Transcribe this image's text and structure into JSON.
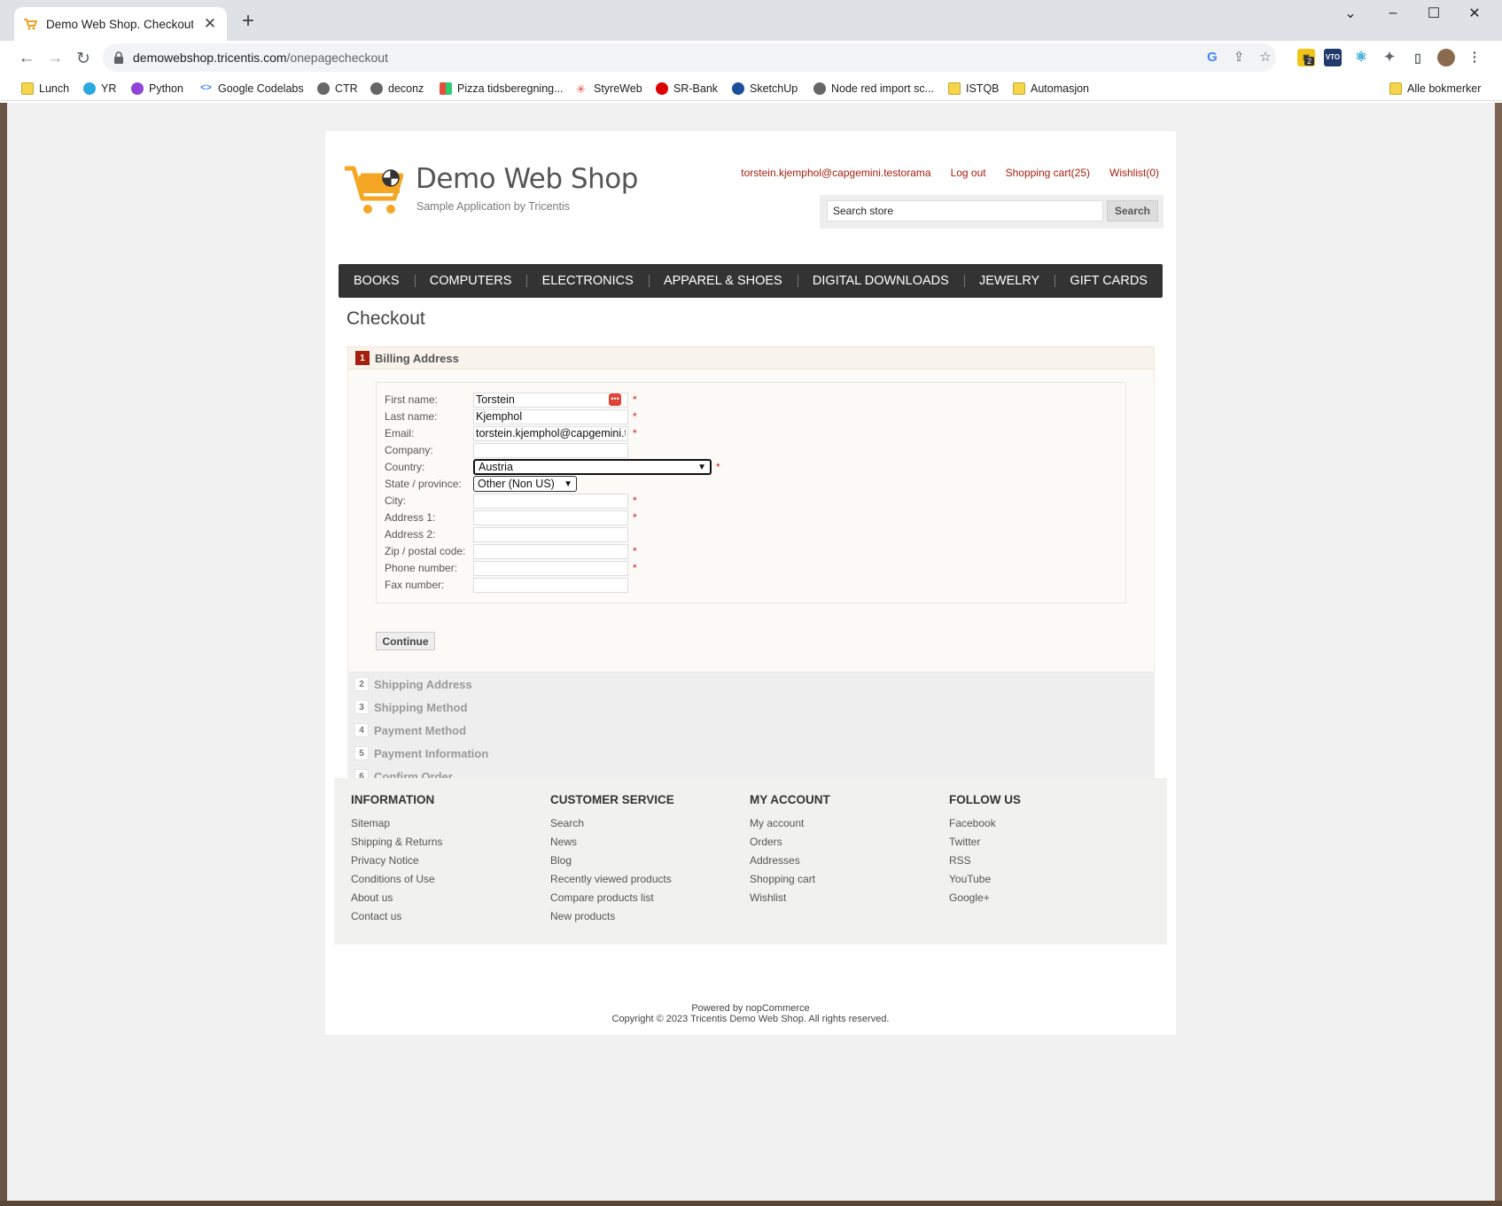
{
  "browser": {
    "tab_title": "Demo Web Shop. Checkout",
    "url_host": "demowebshop.tricentis.com",
    "url_path": "/onepagecheckout",
    "bookmarks": [
      "Lunch",
      "YR",
      "Python",
      "Google Codelabs",
      "CTR",
      "deconz",
      "Pizza tidsberegning...",
      "StyreWeb",
      "SR-Bank",
      "SketchUp",
      "Node red import sc...",
      "ISTQB",
      "Automasjon"
    ],
    "all_bookmarks": "Alle bokmerker",
    "extension_badge": "2"
  },
  "header": {
    "title": "Demo Web Shop",
    "subtitle": "Sample Application by Tricentis",
    "account_email": "torstein.kjemphol@capgemini.testorama",
    "logout": "Log out",
    "cart": "Shopping cart(25)",
    "wishlist": "Wishlist(0)",
    "search_placeholder": "Search store",
    "search_button": "Search"
  },
  "menu": [
    "BOOKS",
    "COMPUTERS",
    "ELECTRONICS",
    "APPAREL & SHOES",
    "DIGITAL DOWNLOADS",
    "JEWELRY",
    "GIFT CARDS"
  ],
  "checkout": {
    "title": "Checkout",
    "active_step": {
      "num": "1",
      "label": "Billing Address"
    },
    "fields": {
      "first_name": {
        "label": "First name:",
        "value": "Torstein"
      },
      "last_name": {
        "label": "Last name:",
        "value": "Kjemphol"
      },
      "email": {
        "label": "Email:",
        "value": "torstein.kjemphol@capgemini.testorama"
      },
      "company": {
        "label": "Company:",
        "value": ""
      },
      "country": {
        "label": "Country:",
        "value": "Austria"
      },
      "state": {
        "label": "State / province:",
        "value": "Other (Non US)"
      },
      "city": {
        "label": "City:",
        "value": ""
      },
      "address1": {
        "label": "Address 1:",
        "value": ""
      },
      "address2": {
        "label": "Address 2:",
        "value": ""
      },
      "zip": {
        "label": "Zip / postal code:",
        "value": ""
      },
      "phone": {
        "label": "Phone number:",
        "value": ""
      },
      "fax": {
        "label": "Fax number:",
        "value": ""
      }
    },
    "required_mark": "*",
    "continue": "Continue",
    "steps": [
      {
        "num": "2",
        "label": "Shipping Address"
      },
      {
        "num": "3",
        "label": "Shipping Method"
      },
      {
        "num": "4",
        "label": "Payment Method"
      },
      {
        "num": "5",
        "label": "Payment Information"
      },
      {
        "num": "6",
        "label": "Confirm Order"
      }
    ]
  },
  "footer": {
    "information": {
      "title": "INFORMATION",
      "links": [
        "Sitemap",
        "Shipping & Returns",
        "Privacy Notice",
        "Conditions of Use",
        "About us",
        "Contact us"
      ]
    },
    "customer_service": {
      "title": "CUSTOMER SERVICE",
      "links": [
        "Search",
        "News",
        "Blog",
        "Recently viewed products",
        "Compare products list",
        "New products"
      ]
    },
    "my_account": {
      "title": "MY ACCOUNT",
      "links": [
        "My account",
        "Orders",
        "Addresses",
        "Shopping cart",
        "Wishlist"
      ]
    },
    "follow_us": {
      "title": "FOLLOW US",
      "links": [
        "Facebook",
        "Twitter",
        "RSS",
        "YouTube",
        "Google+"
      ]
    },
    "powered": "Powered by nopCommerce",
    "copyright": "Copyright © 2023 Tricentis Demo Web Shop. All rights reserved."
  }
}
